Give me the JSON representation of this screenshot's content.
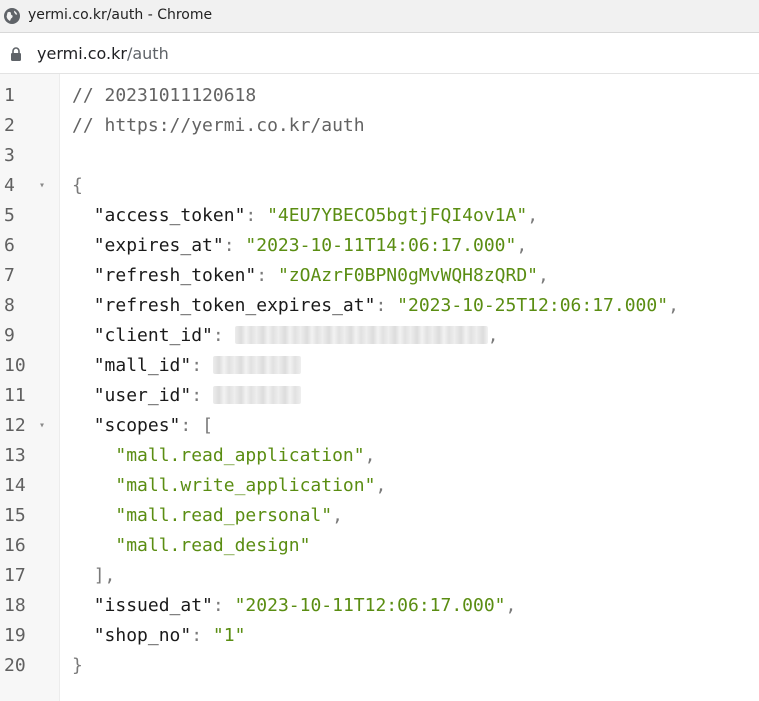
{
  "window": {
    "title": "yermi.co.kr/auth - Chrome"
  },
  "address": {
    "host": "yermi.co.kr",
    "path": "/auth"
  },
  "icons": {
    "tab": "globe-icon",
    "address": "lock-icon",
    "fold": "fold-arrow-icon"
  },
  "colors": {
    "string": "#5a8d12",
    "comment": "#636363",
    "key": "#1a1a1a",
    "punctuation": "#7a7a7a",
    "gutter_bg": "#f7f7f7"
  },
  "lines": [
    {
      "num": "1",
      "indent": "",
      "comment": "// 20231011120618"
    },
    {
      "num": "2",
      "indent": "",
      "comment": "// https://yermi.co.kr/auth"
    },
    {
      "num": "3",
      "indent": ""
    },
    {
      "num": "4",
      "indent": "",
      "fold": "▾",
      "open": "{"
    },
    {
      "num": "5",
      "indent": "  ",
      "key": "\"access_token\"",
      "sep": ": ",
      "value": "\"4EU7YBECO5bgtjFQI4ov1A\"",
      "trail": ","
    },
    {
      "num": "6",
      "indent": "  ",
      "key": "\"expires_at\"",
      "sep": ": ",
      "value": "\"2023-10-11T14:06:17.000\"",
      "trail": ","
    },
    {
      "num": "7",
      "indent": "  ",
      "key": "\"refresh_token\"",
      "sep": ": ",
      "value": "\"zOAzrF0BPN0gMvWQH8zQRD\"",
      "trail": ","
    },
    {
      "num": "8",
      "indent": "  ",
      "key": "\"refresh_token_expires_at\"",
      "sep": ": ",
      "value": "\"2023-10-25T12:06:17.000\"",
      "trail": ","
    },
    {
      "num": "9",
      "indent": "  ",
      "key": "\"client_id\"",
      "sep": ": ",
      "redacted": true,
      "redact_chars": 23,
      "trail": ","
    },
    {
      "num": "10",
      "indent": "  ",
      "key": "\"mall_id\"",
      "sep": ": ",
      "redacted": true,
      "redact_chars": 8
    },
    {
      "num": "11",
      "indent": "  ",
      "key": "\"user_id\"",
      "sep": ": ",
      "redacted": true,
      "redact_chars": 8
    },
    {
      "num": "12",
      "indent": "  ",
      "fold": "▾",
      "key": "\"scopes\"",
      "sep": ": ",
      "open": "["
    },
    {
      "num": "13",
      "indent": "    ",
      "value": "\"mall.read_application\"",
      "trail": ","
    },
    {
      "num": "14",
      "indent": "    ",
      "value": "\"mall.write_application\"",
      "trail": ","
    },
    {
      "num": "15",
      "indent": "    ",
      "value": "\"mall.read_personal\"",
      "trail": ","
    },
    {
      "num": "16",
      "indent": "    ",
      "value": "\"mall.read_design\""
    },
    {
      "num": "17",
      "indent": "  ",
      "close": "]",
      "trail": ","
    },
    {
      "num": "18",
      "indent": "  ",
      "key": "\"issued_at\"",
      "sep": ": ",
      "value": "\"2023-10-11T12:06:17.000\"",
      "trail": ","
    },
    {
      "num": "19",
      "indent": "  ",
      "key": "\"shop_no\"",
      "sep": ": ",
      "value": "\"1\""
    },
    {
      "num": "20",
      "indent": "",
      "close": "}"
    }
  ]
}
